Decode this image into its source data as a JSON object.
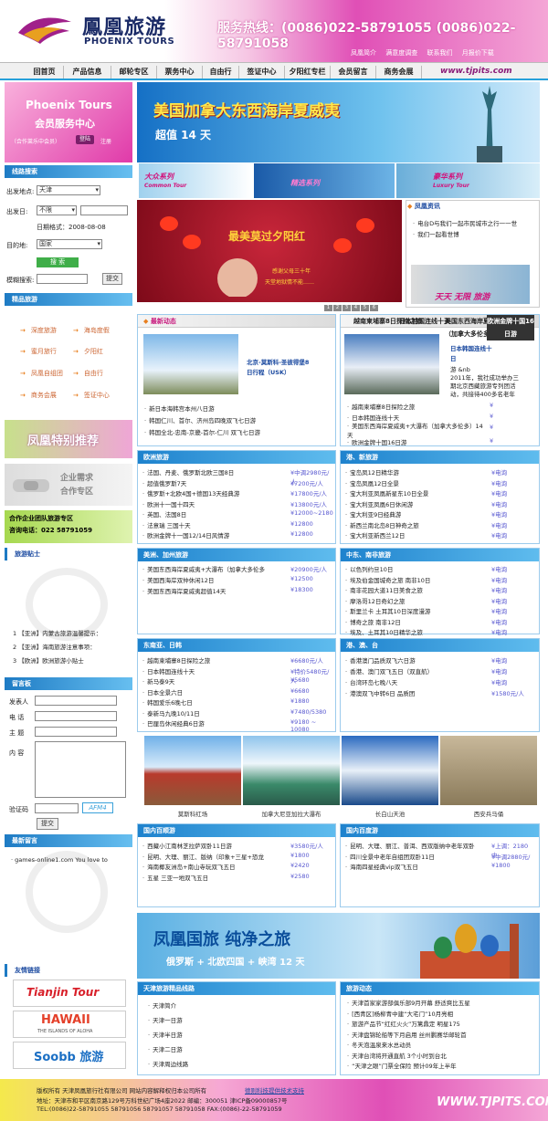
{
  "header": {
    "brand_cn": "鳳凰旅游",
    "brand_en": "PHOENIX TOURS",
    "hotline": "服务热线：(0086)022-58791055  (0086)022-58791058",
    "links": [
      "凤凰简介",
      "满意度调查",
      "联系我们",
      "月报价下载"
    ]
  },
  "nav": {
    "items": [
      "回首页",
      "产品信息",
      "邮轮专区",
      "票务中心",
      "自由行",
      "签证中心",
      "夕阳红专栏",
      "会员留言",
      "商务会展"
    ],
    "url": "www.tjpits.com"
  },
  "member": {
    "t1": "Phoenix Tours",
    "t2": "会员服务中心",
    "t3": "（合作莱乐中会员）",
    "btn": "登陆",
    "reg": "注册"
  },
  "search": {
    "title": "线路搜索",
    "from_label": "出发地点:",
    "from_val": "天津",
    "date_label": "出发日:",
    "date_val": "不限",
    "date_fmt": "日期格式：2008-08-08",
    "dest_label": "目的地:",
    "dest_val": "国家",
    "btn": "搜 索",
    "fuzzy_label": "模糊搜索:",
    "fuzzy_btn": "提交"
  },
  "tour": {
    "title": "精品旅游",
    "items": [
      "深度旅游",
      "海岛度假",
      "蜜月旅行",
      "夕阳红",
      "凤凰自组团",
      "自由行",
      "商务会展",
      "签证中心"
    ]
  },
  "ads": {
    "special": "凤凰特别推荐",
    "biz1": "企业需求",
    "biz2": "合作专区",
    "coop1": "合作企业团队旅游专区",
    "coop2": "咨询电话：022 58791059"
  },
  "tips": {
    "title": "旅游贴士",
    "items": [
      "1  【亚洲】内蒙古旅游温馨提示：",
      "2  【亚洲】海南旅游注意事项：",
      "3  【欧洲】欧洲旅游小贴士"
    ]
  },
  "guest": {
    "title": "留言板",
    "name": "发表人",
    "tel": "电 话",
    "subject": "主 题",
    "content": "内 容",
    "code_label": "验证码",
    "code": "AFM4",
    "btn": "提交"
  },
  "latest": {
    "title": "最新留言",
    "text": "· games-online1.com You love to"
  },
  "friends": {
    "title": "友情链接",
    "l1": "Tianjin Tour",
    "l2": "HAWAII",
    "l2s": "THE ISLANDS OF ALOHA",
    "l3": "Soobb 旅游"
  },
  "banner1": {
    "t1": "美国加拿大东西海岸夏威夷",
    "t2": "超值 14 天"
  },
  "strip": {
    "a": "大众系列",
    "a2": "Common Tour",
    "b": "精选系列",
    "c": "豪华系列",
    "c2": "Luxury Tour"
  },
  "red": {
    "t1": "最美莫过夕阳红",
    "t2": "感谢父母三十年",
    "t3": "天堂地狱情不能……"
  },
  "pager": [
    "1",
    "2",
    "3",
    "4",
    "5",
    "6"
  ],
  "newsinfo": {
    "title": "凤凰资讯",
    "items": [
      "电台D与我们一起市民城市之行一一世",
      "我们一起看世博"
    ],
    "pic": "天天 无限 旅游"
  },
  "trends": {
    "title": "最新动态",
    "pic_cap1": "北京-莫斯科-圣彼得堡8",
    "pic_cap2": "日行程（USK）",
    "items": [
      "新日本海韩宫本州八日游",
      "韩国仁川、首尔、济州岛四晚双飞七日游",
      "韩国全北-忠南-京畿-首尔-仁川 双飞七日游"
    ]
  },
  "tabs": {
    "items": [
      "越南柬埔寨8日探险之旅",
      "日本韩国连线十天",
      "美国东西海岸夏威夷+大瀑布（加拿大多伦多）14天",
      "欧洲金牌十国16日游"
    ],
    "r_title": "日本韩国连线十",
    "r_title2": "日",
    "r_desc": [
      "游 &nb",
      "2011年，我社成功举办三",
      "期北京西藏旅游专列团活",
      "动，共接待400多名老年"
    ],
    "sign": "¥"
  },
  "europe": {
    "title": "欧洲旅游",
    "items": [
      [
        "法国、丹麦、俄罗斯北欧三国8日",
        "¥中调2980元/人"
      ],
      [
        "超值俄罗斯7天",
        "¥7200元/人"
      ],
      [
        "俄罗斯+北欧4国+德国13天经典游",
        "¥17800元/人"
      ],
      [
        "欧洲十一国十四天",
        "¥13800元/人"
      ],
      [
        "英国、法国8日",
        "¥12000~2180"
      ],
      [
        "法意瑞 三国十天",
        "¥12800"
      ],
      [
        "欧洲金牌十一国12/14日风情游",
        "¥12800"
      ]
    ]
  },
  "taiwan": {
    "title": "港、新旅游",
    "items": [
      "宝岛凤12日精华游",
      "宝岛凤凰12日全景",
      "宝大利亚凤凰新星东10日全景",
      "宝大利亚凤凰6日休闲游",
      "宝大利亚9日经典游",
      "新西兰南北岛8日神奇之旅",
      "宝大利亚新西兰12日"
    ],
    "price": "¥电询"
  },
  "america": {
    "title": "美洲、加州旅游",
    "items": [
      [
        "美国东西海岸夏威夷+大瀑布（加拿大多伦多",
        "¥20900元/人"
      ],
      [
        "美国西海岸双仲休闲12日",
        "¥12500"
      ],
      [
        "美国东西海岸夏威夷超值14天",
        "¥18300"
      ]
    ]
  },
  "china": {
    "title": "中东、南非旅游",
    "items": [
      "以色列约旦10日",
      "埃及伯金国城奇之旅 南非10日",
      "南非花园大道11日美食之旅",
      "摩洛哥12日奇幻之旅",
      "斯里兰卡 土耳其10日深度漫游",
      "博奇之旅 南非12日",
      "埃及、土耳其10日精华之旅"
    ],
    "price": "¥电询"
  },
  "sea": {
    "title": "东南亚、日韩",
    "items": [
      [
        "越南柬埔寨8日探险之旅",
        "¥6680元/人"
      ],
      [
        "日本韩国连线十天",
        "¥特价5480元/人"
      ],
      [
        "新马泰9天",
        "¥5680"
      ],
      [
        "日本全景六日",
        "¥6680"
      ],
      [
        "韩国爱乐6晚七日",
        "¥1880"
      ],
      [
        "泰新马九晚10/11日",
        "¥7480/5380"
      ],
      [
        "巴厘岛休闲经典6日游",
        "¥9180 ~ 10080"
      ]
    ]
  },
  "hk": {
    "title": "港、澳、台",
    "items": [
      "香港澳门品质双飞六日游",
      "香港、澳门双飞五日（双直航）",
      "台湾环岛七晚八天",
      "港澳双飞中转6日 品质团"
    ],
    "price": "¥电询",
    "last": "¥1580元/人"
  },
  "photos": [
    "莫斯科红场",
    "加拿大尼亚加拉大瀑布",
    "长白山天池",
    "西安兵马俑"
  ],
  "domestic": {
    "title": "国内百顺游",
    "items": [
      [
        "西藏小江南林芝拉萨双卧11日游",
        "¥3580元/人"
      ],
      [
        "昆明、大理、丽江、版纳（印象+三星+恐龙",
        "¥1800"
      ],
      [
        "海南椰友洲岛+南山寺玩双飞五日",
        "¥2420"
      ],
      [
        "五星 三亚一地双飞五日",
        "¥2580"
      ]
    ]
  },
  "domestic2": {
    "title": "国内百度游",
    "items": [
      [
        "昆明、大理、丽江、普洱、西双版纳中老年双卧",
        "¥上调：2180 中"
      ],
      [
        "四川全景中老年自组团双卧11日",
        "¥中调2880元/"
      ],
      [
        "海南四星经典vip双飞五日",
        "¥1800"
      ]
    ]
  },
  "banner2": {
    "t1": "凤凰国旅 纯净之旅",
    "t2": "俄罗斯 + 北欧四国 + 峡湾 12 天"
  },
  "tj": {
    "title": "天津旅游精品线路",
    "items": [
      "天津简介",
      "天津一日游",
      "天津半日游",
      "天津二日游",
      "天津周边线路"
    ]
  },
  "news2": {
    "title": "旅游动态",
    "items": [
      "天津首家家游部俱乐部9月开幕 舒适爽比五星",
      "[西青区]杨柳青中建“大宅门”10月亮相",
      "旅游产品节“红红火火”万篱鼎定 明星175",
      "天津盘锦轮船等下月启用 丝州鹏赛华邮轮首",
      "冬天泡温泉来水总动员",
      "天津台湾将开通直航 3个小时到台北",
      "“天津之眼”门票全保险 预计09年上半年"
    ]
  },
  "footer": {
    "l1": "版权所有 天津凤凰旅行社有限公司 网站内容解释权归本公司所有",
    "tech": "德则科技提供技术支持",
    "l2": "地址：天津市和平区南京路129号万科世纪广场4座2022  邮编：300051  津ICP备09000857号",
    "l3": "TEL:(0086)22-58791055 58791056 58791057 58791058 FAX:(0086)-22-58791059",
    "url": "WWW.TJPITS.COM"
  }
}
